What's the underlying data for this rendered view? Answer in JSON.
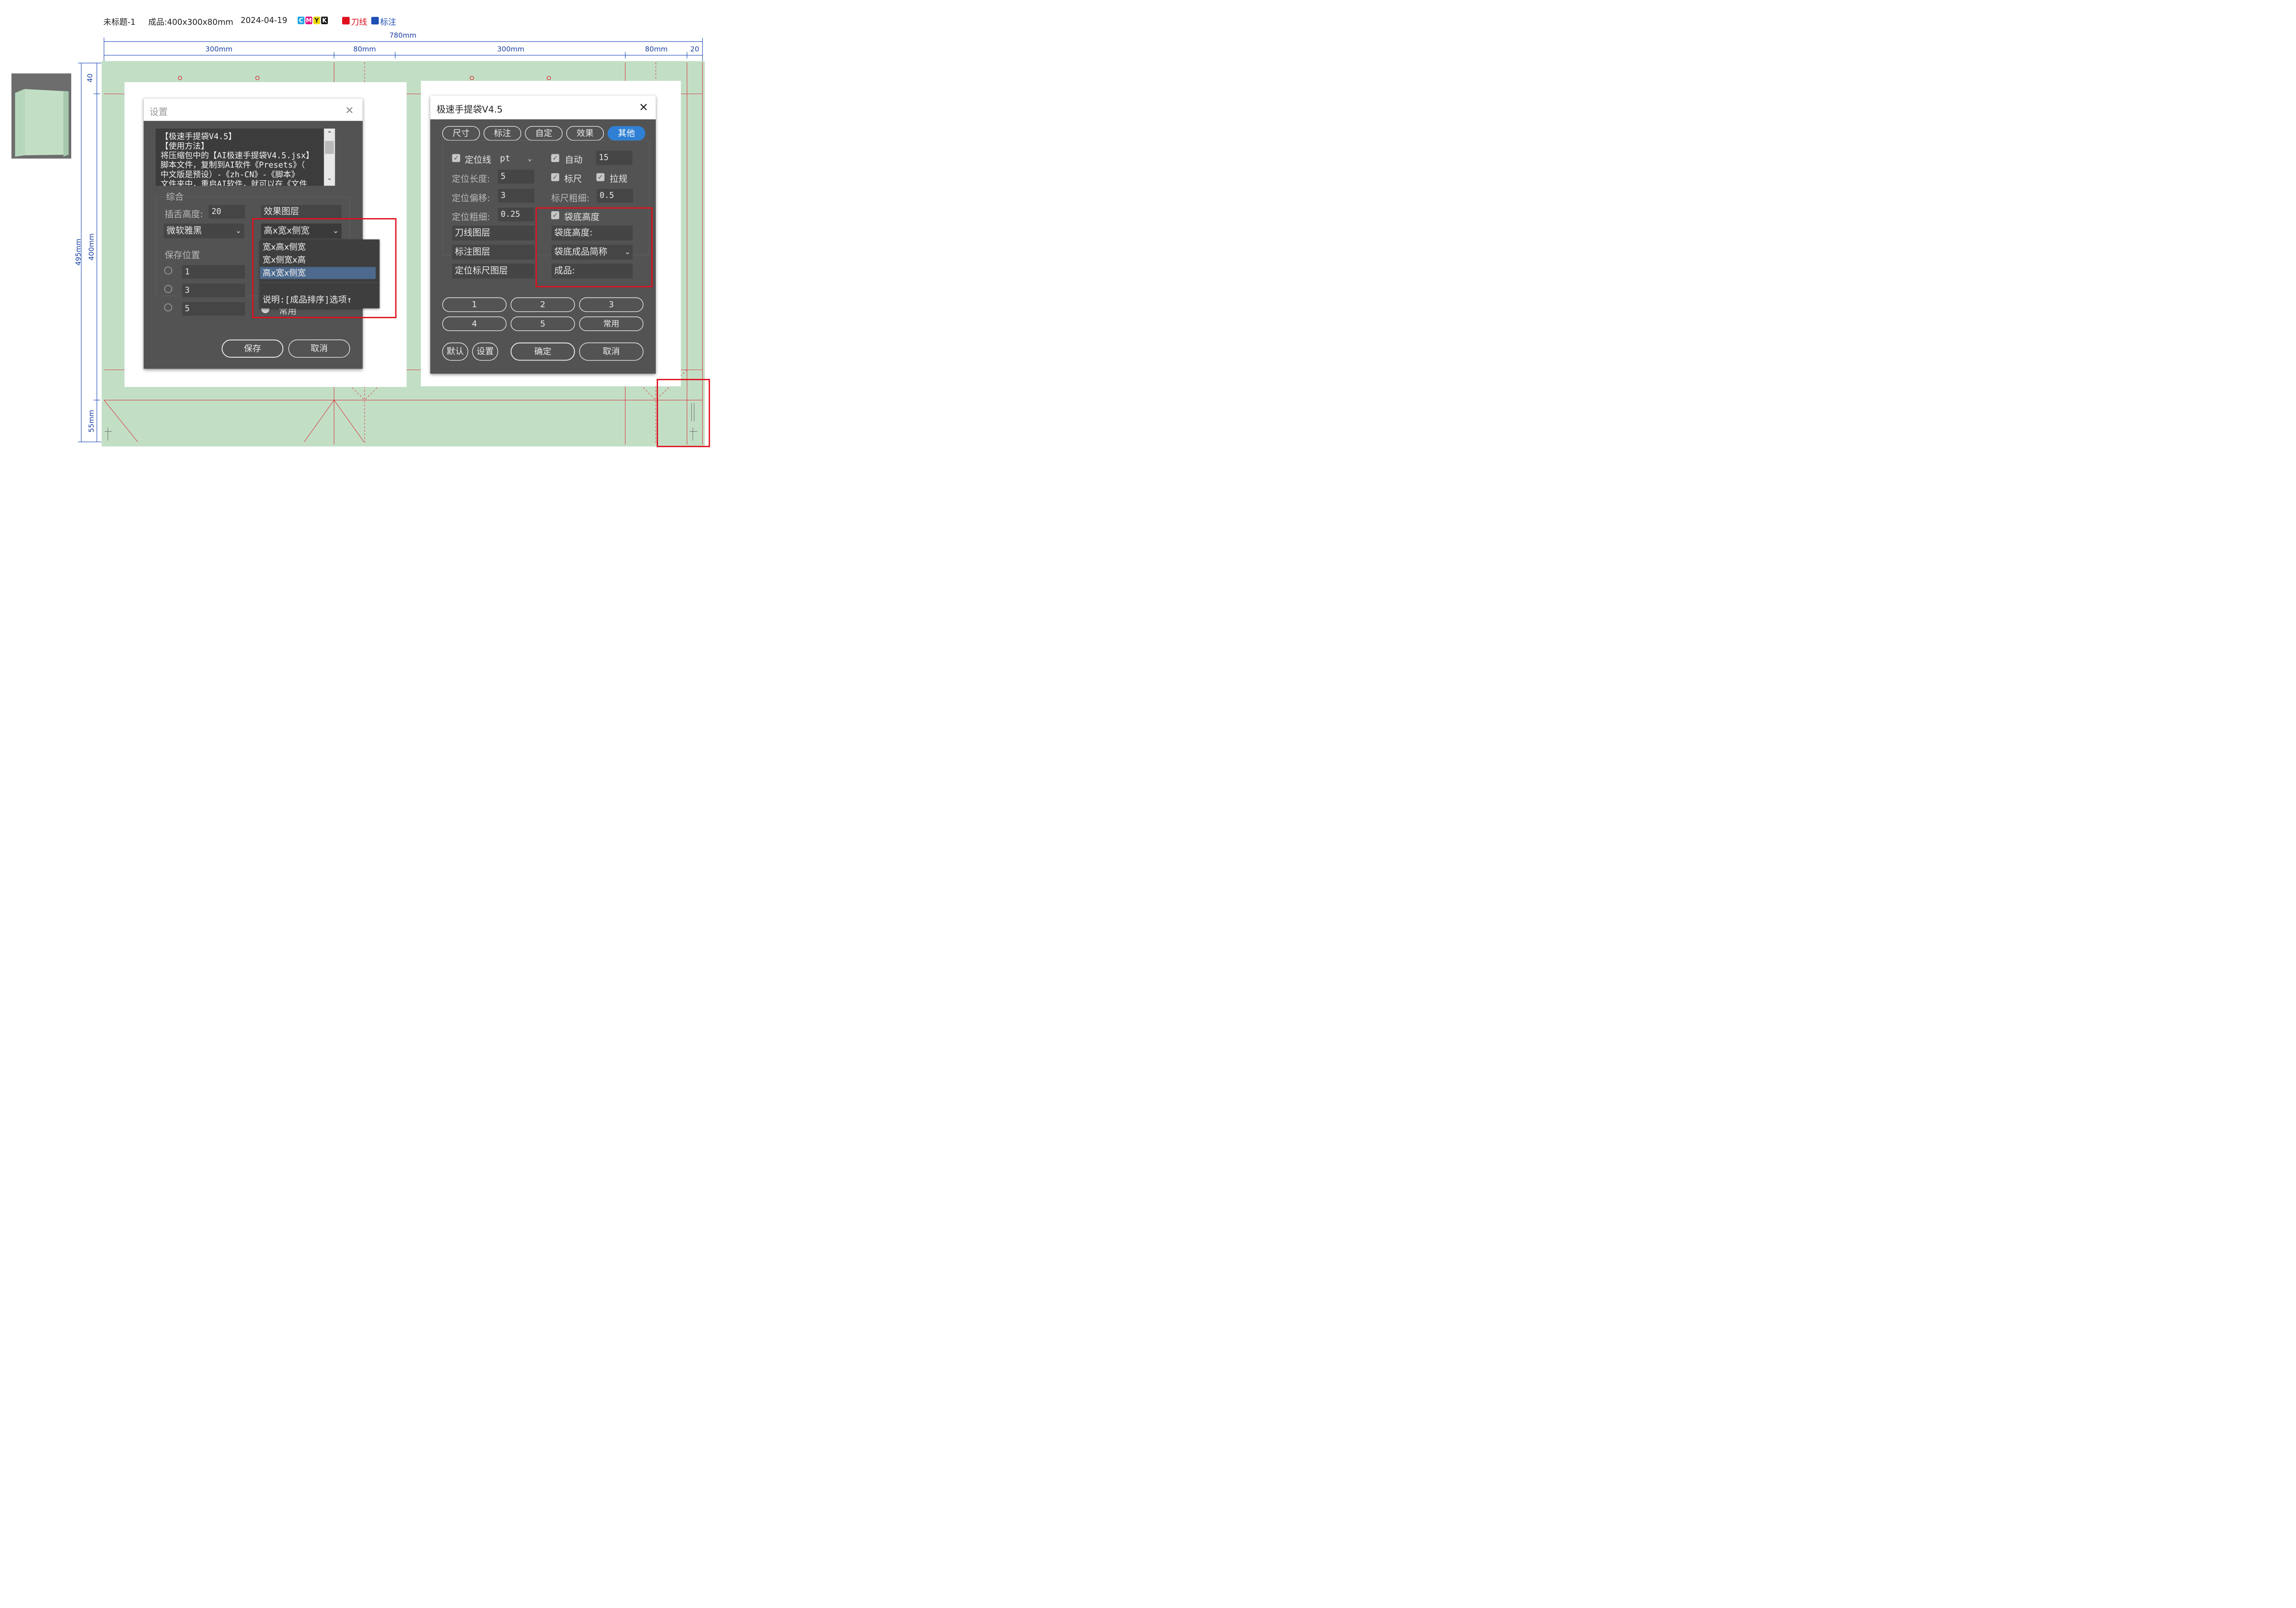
{
  "header": {
    "doc_title": "未标题-1",
    "product_size": "成品:400x300x80mm",
    "date": "2024-04-19",
    "color_chips": [
      {
        "letter": "C",
        "color": "#1aa3e0"
      },
      {
        "letter": "M",
        "color": "#e0007a"
      },
      {
        "letter": "Y",
        "color": "#f2d800"
      },
      {
        "letter": "K",
        "color": "#111111"
      }
    ],
    "die_line_label": "刀线",
    "die_line_color": "#e0101e",
    "annotation_label": "标注",
    "annotation_color": "#1f4fb4"
  },
  "dimensions": {
    "total_width": "780mm",
    "segments": [
      "300mm",
      "80mm",
      "300mm",
      "80mm",
      "20"
    ],
    "left_total": "495mm",
    "left_parts": [
      "40",
      "400mm",
      "55mm"
    ]
  },
  "canvas": {
    "background": "#c2dfc6",
    "die_line_color": "#e0101e"
  },
  "settings_dialog": {
    "title": "设置",
    "text_lines": [
      "【极速手提袋V4.5】",
      "【使用方法】",
      "将压缩包中的【AI极速手提袋V4.5.jsx】",
      "脚本文件，复制到AI软件《Presets》（",
      "中文版是预设）-《zh-CN》-《脚本》",
      "文件夹中，重启AI软件，就可以在《文件"
    ],
    "group_general": "综合",
    "tongue_height_label": "插舌高度:",
    "tongue_height_value": "20",
    "effect_layer_label": "效果图层",
    "font_select": "微软雅黑",
    "order_select": "高x宽x侧宽",
    "order_options": [
      "宽x高x侧宽",
      "宽x侧宽x高",
      "高x宽x侧宽"
    ],
    "order_selected_index": 2,
    "order_note": "说明:[成品排序]选项↑",
    "group_save": "保存位置",
    "save_slots": [
      "1",
      "3",
      "5"
    ],
    "common_label": "常用",
    "save_button": "保存",
    "cancel_button": "取消"
  },
  "main_dialog": {
    "title": "极速手提袋V4.5",
    "tabs": [
      "尺寸",
      "标注",
      "自定",
      "效果",
      "其他"
    ],
    "active_tab_index": 4,
    "locator_line_label": "定位线",
    "locator_line_checked": true,
    "unit_select": "pt",
    "auto_label": "自动",
    "auto_checked": true,
    "auto_value": "15",
    "locator_length_label": "定位长度:",
    "locator_length_value": "5",
    "ruler_label": "标尺",
    "ruler_checked": true,
    "crease_label": "拉规",
    "crease_checked": true,
    "locator_offset_label": "定位偏移:",
    "locator_offset_value": "3",
    "ruler_weight_label": "标尺粗细:",
    "ruler_weight_value": "0.5",
    "locator_weight_label": "定位粗细:",
    "locator_weight_value": "0.25",
    "bottom_height_label": "袋底高度",
    "bottom_height_checked": true,
    "die_layer_field": "刀线图层",
    "bottom_height_field": "袋底高度:",
    "annotation_layer_field": "标注图层",
    "bottom_abbrev_select": "袋底成品简称",
    "locator_ruler_layer_field": "定位标尺图层",
    "product_field": "成品:",
    "preset_buttons": [
      "1",
      "2",
      "3",
      "4",
      "5",
      "常用"
    ],
    "default_button": "默认",
    "settings_button": "设置",
    "ok_button": "确定",
    "cancel_button": "取消"
  }
}
